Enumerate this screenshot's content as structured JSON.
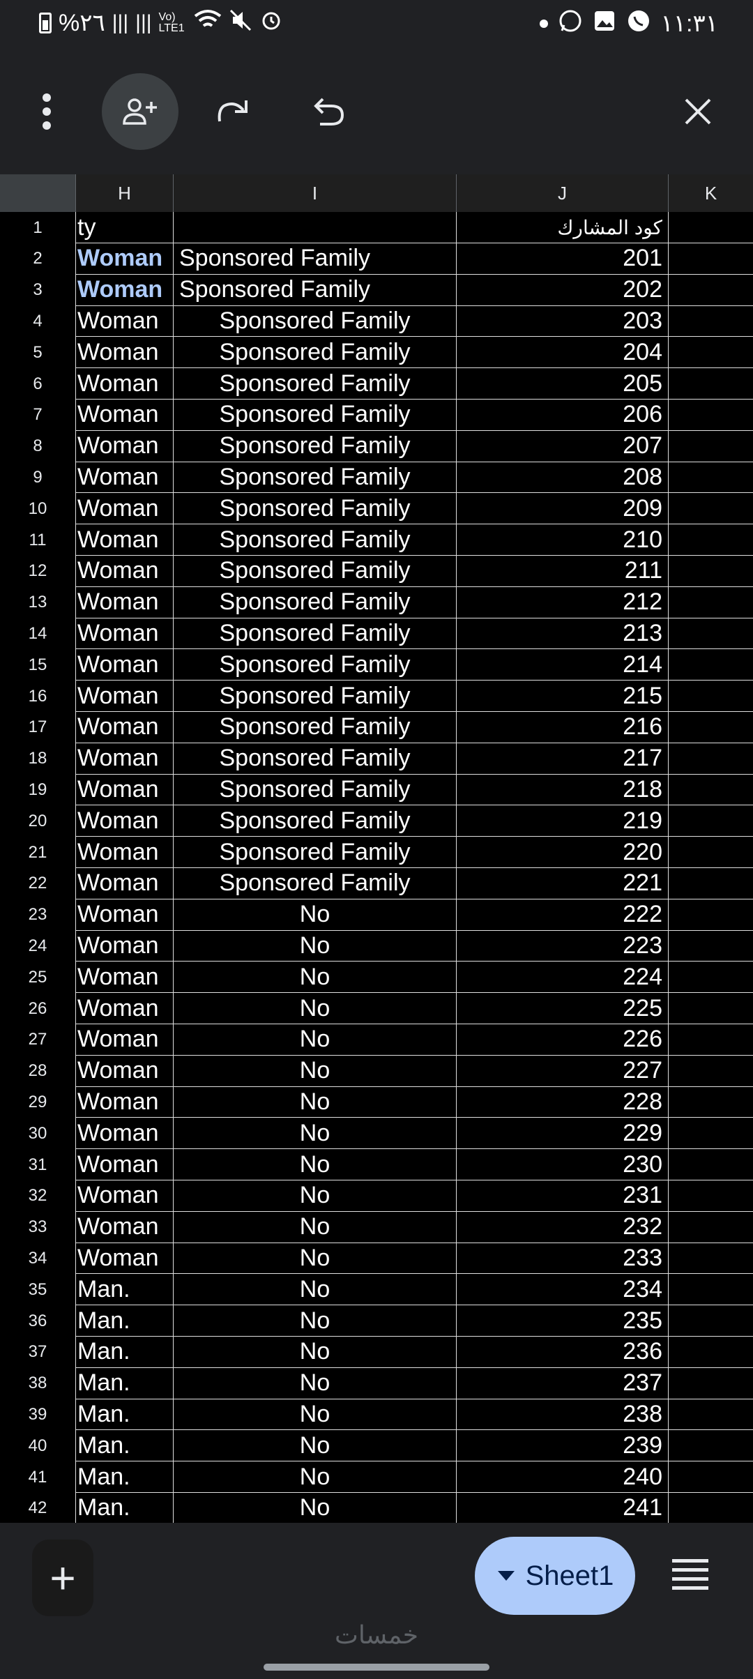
{
  "status_bar": {
    "left_text": "%٢٦",
    "signal_label": "Vo) LTE1",
    "time": "١١:٣١"
  },
  "toolbar": {
    "more_icon": "more-vert-icon",
    "share_icon": "person-add-icon",
    "redo_icon": "redo-icon",
    "undo_icon": "undo-icon",
    "close_icon": "close-icon"
  },
  "columns": [
    "H",
    "I",
    "J",
    "K"
  ],
  "rows": [
    {
      "num": "1",
      "H": "ty",
      "I": "",
      "J": "كود المشارك",
      "style": "plain",
      "i_align": "center"
    },
    {
      "num": "2",
      "H": "Woman",
      "I": "Sponsored Family",
      "J": "201",
      "style": "bold",
      "i_align": "left"
    },
    {
      "num": "3",
      "H": "Woman",
      "I": "Sponsored Family",
      "J": "202",
      "style": "bold",
      "i_align": "left"
    },
    {
      "num": "4",
      "H": "Woman",
      "I": "Sponsored Family",
      "J": "203",
      "style": "plain",
      "i_align": "center"
    },
    {
      "num": "5",
      "H": "Woman",
      "I": "Sponsored Family",
      "J": "204",
      "style": "plain",
      "i_align": "center"
    },
    {
      "num": "6",
      "H": "Woman",
      "I": "Sponsored Family",
      "J": "205",
      "style": "plain",
      "i_align": "center"
    },
    {
      "num": "7",
      "H": "Woman",
      "I": "Sponsored Family",
      "J": "206",
      "style": "plain",
      "i_align": "center"
    },
    {
      "num": "8",
      "H": "Woman",
      "I": "Sponsored Family",
      "J": "207",
      "style": "plain",
      "i_align": "center"
    },
    {
      "num": "9",
      "H": "Woman",
      "I": "Sponsored Family",
      "J": "208",
      "style": "plain",
      "i_align": "center"
    },
    {
      "num": "10",
      "H": "Woman",
      "I": "Sponsored Family",
      "J": "209",
      "style": "plain",
      "i_align": "center"
    },
    {
      "num": "11",
      "H": "Woman",
      "I": "Sponsored Family",
      "J": "210",
      "style": "plain",
      "i_align": "center"
    },
    {
      "num": "12",
      "H": "Woman",
      "I": "Sponsored Family",
      "J": "211",
      "style": "plain",
      "i_align": "center"
    },
    {
      "num": "13",
      "H": "Woman",
      "I": "Sponsored Family",
      "J": "212",
      "style": "plain",
      "i_align": "center"
    },
    {
      "num": "14",
      "H": "Woman",
      "I": "Sponsored Family",
      "J": "213",
      "style": "plain",
      "i_align": "center"
    },
    {
      "num": "15",
      "H": "Woman",
      "I": "Sponsored Family",
      "J": "214",
      "style": "plain",
      "i_align": "center"
    },
    {
      "num": "16",
      "H": "Woman",
      "I": "Sponsored Family",
      "J": "215",
      "style": "plain",
      "i_align": "center"
    },
    {
      "num": "17",
      "H": "Woman",
      "I": "Sponsored Family",
      "J": "216",
      "style": "plain",
      "i_align": "center"
    },
    {
      "num": "18",
      "H": "Woman",
      "I": "Sponsored Family",
      "J": "217",
      "style": "plain",
      "i_align": "center"
    },
    {
      "num": "19",
      "H": "Woman",
      "I": "Sponsored Family",
      "J": "218",
      "style": "plain",
      "i_align": "center"
    },
    {
      "num": "20",
      "H": "Woman",
      "I": "Sponsored Family",
      "J": "219",
      "style": "plain",
      "i_align": "center"
    },
    {
      "num": "21",
      "H": "Woman",
      "I": "Sponsored Family",
      "J": "220",
      "style": "plain",
      "i_align": "center"
    },
    {
      "num": "22",
      "H": "Woman",
      "I": "Sponsored Family",
      "J": "221",
      "style": "plain",
      "i_align": "center"
    },
    {
      "num": "23",
      "H": "Woman",
      "I": "No",
      "J": "222",
      "style": "plain",
      "i_align": "center"
    },
    {
      "num": "24",
      "H": "Woman",
      "I": "No",
      "J": "223",
      "style": "plain",
      "i_align": "center"
    },
    {
      "num": "25",
      "H": "Woman",
      "I": "No",
      "J": "224",
      "style": "plain",
      "i_align": "center"
    },
    {
      "num": "26",
      "H": "Woman",
      "I": "No",
      "J": "225",
      "style": "plain",
      "i_align": "center"
    },
    {
      "num": "27",
      "H": "Woman",
      "I": "No",
      "J": "226",
      "style": "plain",
      "i_align": "center"
    },
    {
      "num": "28",
      "H": "Woman",
      "I": "No",
      "J": "227",
      "style": "plain",
      "i_align": "center"
    },
    {
      "num": "29",
      "H": "Woman",
      "I": "No",
      "J": "228",
      "style": "plain",
      "i_align": "center"
    },
    {
      "num": "30",
      "H": "Woman",
      "I": "No",
      "J": "229",
      "style": "plain",
      "i_align": "center"
    },
    {
      "num": "31",
      "H": "Woman",
      "I": "No",
      "J": "230",
      "style": "plain",
      "i_align": "center"
    },
    {
      "num": "32",
      "H": "Woman",
      "I": "No",
      "J": "231",
      "style": "plain",
      "i_align": "center"
    },
    {
      "num": "33",
      "H": "Woman",
      "I": "No",
      "J": "232",
      "style": "plain",
      "i_align": "center"
    },
    {
      "num": "34",
      "H": "Woman",
      "I": "No",
      "J": "233",
      "style": "plain",
      "i_align": "center"
    },
    {
      "num": "35",
      "H": "Man.",
      "I": "No",
      "J": "234",
      "style": "plain",
      "i_align": "center"
    },
    {
      "num": "36",
      "H": "Man.",
      "I": "No",
      "J": "235",
      "style": "plain",
      "i_align": "center"
    },
    {
      "num": "37",
      "H": "Man.",
      "I": "No",
      "J": "236",
      "style": "plain",
      "i_align": "center"
    },
    {
      "num": "38",
      "H": "Man.",
      "I": "No",
      "J": "237",
      "style": "plain",
      "i_align": "center"
    },
    {
      "num": "39",
      "H": "Man.",
      "I": "No",
      "J": "238",
      "style": "plain",
      "i_align": "center"
    },
    {
      "num": "40",
      "H": "Man.",
      "I": "No",
      "J": "239",
      "style": "plain",
      "i_align": "center"
    },
    {
      "num": "41",
      "H": "Man.",
      "I": "No",
      "J": "240",
      "style": "plain",
      "i_align": "center"
    },
    {
      "num": "42",
      "H": "Man.",
      "I": "No",
      "J": "241",
      "style": "plain",
      "i_align": "center"
    }
  ],
  "bottom_bar": {
    "add_label": "+",
    "sheet_label": "Sheet1",
    "watermark": "خمسات"
  },
  "colors": {
    "accent": "#aecbfa",
    "background": "#202124",
    "grid_bg": "#000000"
  }
}
